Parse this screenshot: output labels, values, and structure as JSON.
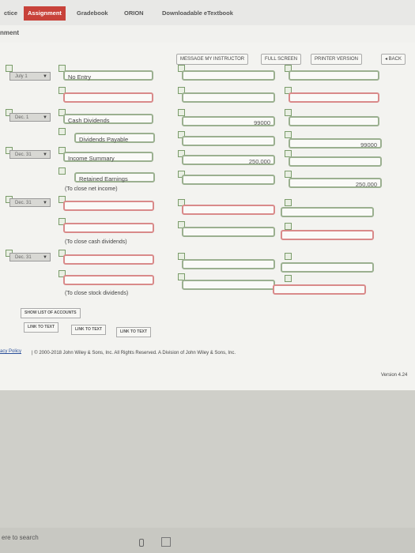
{
  "nav": {
    "tabs": [
      {
        "label": "ctice",
        "active": false
      },
      {
        "label": "Assignment",
        "active": true
      },
      {
        "label": "Gradebook",
        "active": false
      },
      {
        "label": "ORION",
        "active": false
      },
      {
        "label": "Downloadable eTextbook",
        "active": false
      }
    ]
  },
  "page_title": "nment",
  "toolbar": {
    "message": "MESSAGE MY INSTRUCTOR",
    "fullscreen": "FULL SCREEN",
    "printer": "PRINTER VERSION",
    "back": "◂ BACK"
  },
  "rows": [
    {
      "date": "July 1",
      "account": "No Entry",
      "debit": "",
      "credit": "",
      "status": "ok"
    },
    {
      "date": "",
      "account": "",
      "debit": "",
      "credit": "",
      "status": "err"
    },
    {
      "date": "Dec. 1",
      "account": "Cash Dividends",
      "debit": "99000",
      "credit": "",
      "status": "ok"
    },
    {
      "date": "",
      "account": "Dividends Payable",
      "debit": "",
      "credit": "99000",
      "status": "ok"
    },
    {
      "date": "Dec. 31",
      "account": "Income Summary",
      "debit": "250,000",
      "credit": "",
      "status": "ok"
    },
    {
      "date": "",
      "account": "Retained Earnings",
      "debit": "",
      "credit": "250,000",
      "status": "ok"
    },
    {
      "date": "Dec. 31",
      "account": "",
      "debit": "",
      "credit": "",
      "status": "err"
    },
    {
      "date": "",
      "account": "",
      "debit": "",
      "credit": "",
      "status": "err"
    },
    {
      "date": "Dec. 31",
      "account": "",
      "debit": "",
      "credit": "",
      "status": "err"
    },
    {
      "date": "",
      "account": "",
      "debit": "",
      "credit": "",
      "status": "err"
    }
  ],
  "notes": {
    "close_net": "(To close net income)",
    "close_cash": "(To close cash dividends)",
    "close_stock": "(To close stock dividends)"
  },
  "buttons": {
    "show_accounts": "SHOW LIST OF ACCOUNTS",
    "link1": "LINK TO TEXT",
    "link2": "LINK TO TEXT",
    "link3": "LINK TO TEXT"
  },
  "footer": {
    "policy": "acy Policy",
    "copyright": "| © 2000-2018 John Wiley & Sons, Inc. All Rights Reserved. A Division of John Wiley & Sons, Inc.",
    "version": "Version 4.24"
  },
  "taskbar": {
    "search": "ere to search"
  }
}
